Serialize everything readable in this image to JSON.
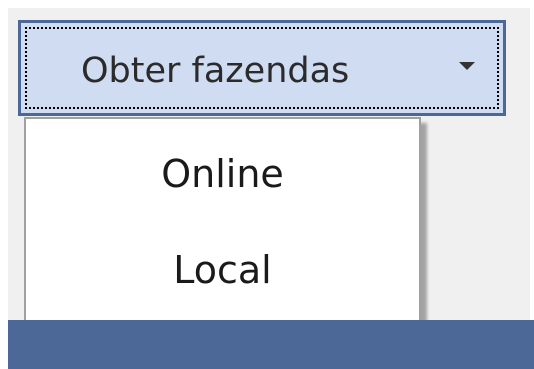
{
  "split_button": {
    "label": "Obter fazendas",
    "dropdown_icon": "caret-down-icon"
  },
  "menu": {
    "items": [
      {
        "label": "Online"
      },
      {
        "label": "Local"
      }
    ]
  },
  "colors": {
    "panel_background": "#f0f0f0",
    "button_background": "#cfdcf2",
    "button_border": "#4b6897",
    "bottom_bar": "#4b6897",
    "menu_background": "#ffffff"
  }
}
